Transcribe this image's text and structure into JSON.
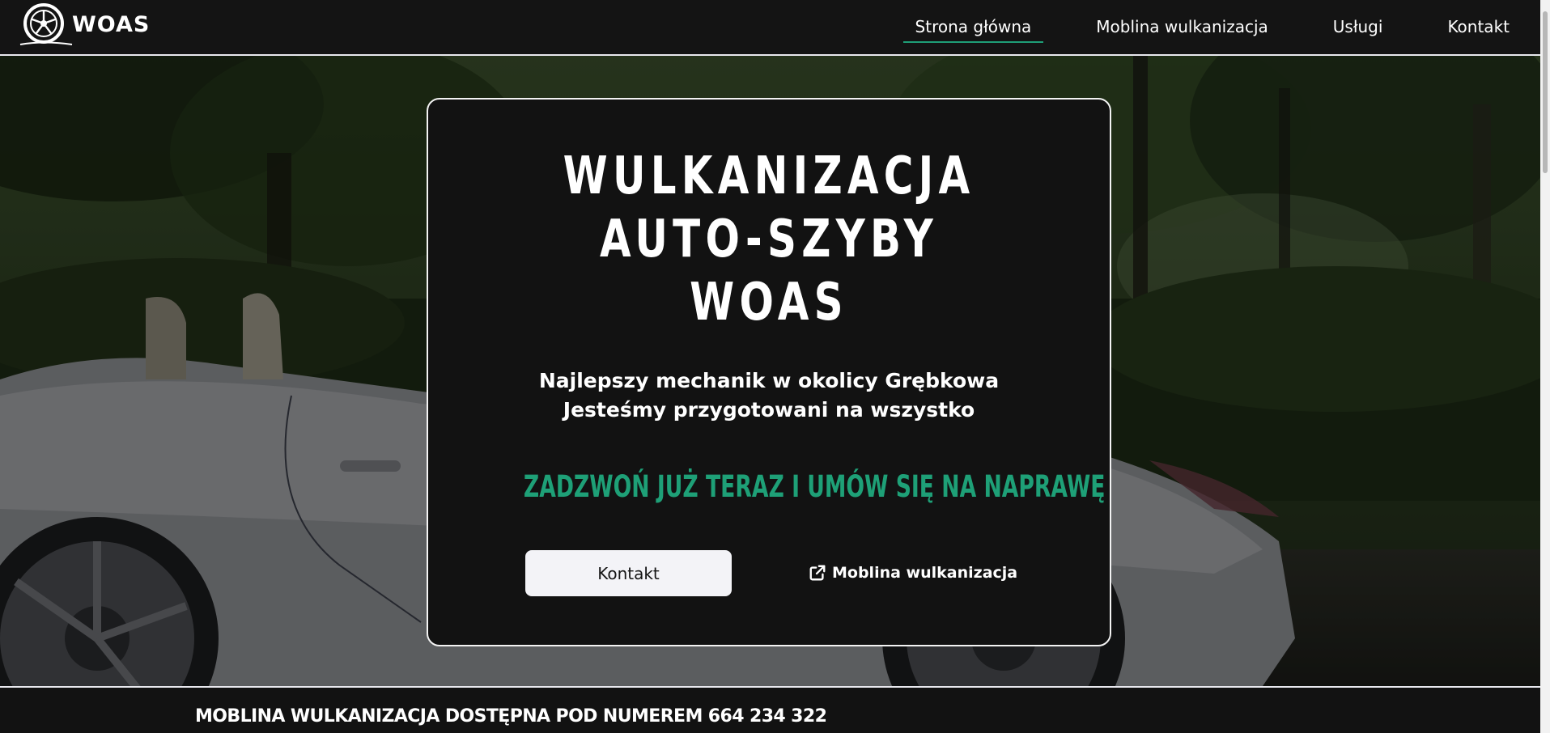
{
  "header": {
    "logo_text": "WOAS",
    "nav": [
      {
        "label": "Strona główna",
        "active": true
      },
      {
        "label": "Moblina wulkanizacja",
        "active": false
      },
      {
        "label": "Usługi",
        "active": false
      },
      {
        "label": "Kontakt",
        "active": false
      }
    ]
  },
  "hero": {
    "title_lines": [
      "WULKANIZACJA",
      "AUTO-SZYBY",
      "WOAS"
    ],
    "subtitle_lines": [
      "Najlepszy mechanik w okolicy Grębkowa",
      "Jesteśmy przygotowani na wszystko"
    ],
    "cta_text": "ZADZWOŃ JUŻ TERAZ I UMÓW SIĘ NA NAPRAWĘ",
    "button_label": "Kontakt",
    "link_label": "Moblina wulkanizacja",
    "link_icon": "external-link-icon"
  },
  "info_bar": {
    "text": "MOBLINA WULKANIZACJA DOSTĘPNA POD NUMEREM 664 234 322"
  },
  "colors": {
    "background": "#121212",
    "accent": "#1ea077",
    "border": "#f3f3f3",
    "button_bg": "#f3f3f7"
  }
}
